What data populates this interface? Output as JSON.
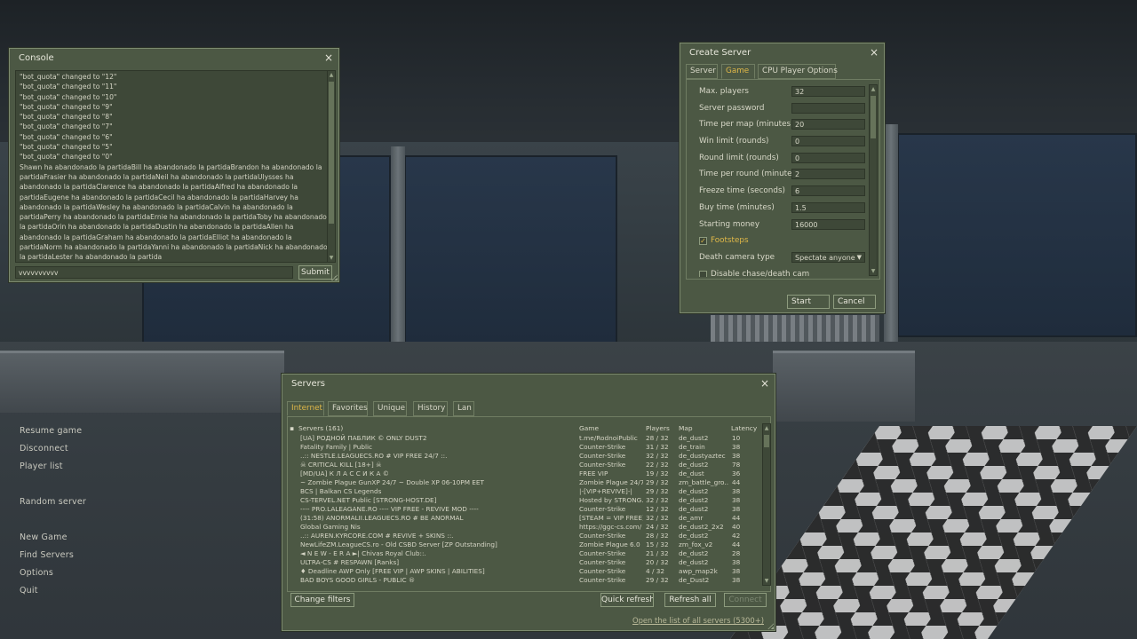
{
  "main_menu": {
    "items": [
      "Resume game",
      "Disconnect",
      "Player list",
      "",
      "Random server",
      "",
      "New Game",
      "Find Servers",
      "Options",
      "Quit"
    ]
  },
  "console": {
    "title": "Console",
    "close_glyph": "×",
    "lines": [
      "\"bot_quota\" changed to \"12\"",
      "\"bot_quota\" changed to \"11\"",
      "\"bot_quota\" changed to \"10\"",
      "\"bot_quota\" changed to \"9\"",
      "\"bot_quota\" changed to \"8\"",
      "\"bot_quota\" changed to \"7\"",
      "\"bot_quota\" changed to \"6\"",
      "\"bot_quota\" changed to \"5\"",
      "\"bot_quota\" changed to \"0\""
    ],
    "paragraph": "Shawn ha abandonado la partidaBill ha abandonado la partidaBrandon ha abandonado la partidaFrasier ha abandonado la partidaNeil ha abandonado la partidaUlysses ha abandonado la partidaClarence ha abandonado la partidaAlfred ha abandonado la partidaEugene ha abandonado la partidaCecil ha abandonado la partidaHarvey ha abandonado la partidaWesley ha abandonado la partidaCalvin ha abandonado la partidaPerry ha abandonado la partidaErnie ha abandonado la partidaToby ha abandonado la partidaOrin ha abandonado la partidaDustin ha abandonado la partidaAllen ha abandonado la partidaGraham ha abandonado la partidaElliot ha abandonado la partidaNorm ha abandonado la partidaYanni ha abandonado la partidaNick ha abandonado la partidaLester ha abandonado la partida",
    "input_value": "vvvvvvvvvv",
    "submit_label": "Submit"
  },
  "create_server": {
    "title": "Create Server",
    "close_glyph": "×",
    "tabs": [
      "Server",
      "Game",
      "CPU Player Options"
    ],
    "active_tab": "Game",
    "fields": [
      {
        "label": "Max. players",
        "value": "32"
      },
      {
        "label": "Server password",
        "value": ""
      },
      {
        "label": "Time per map (minutes)",
        "value": "20"
      },
      {
        "label": "Win limit (rounds)",
        "value": "0"
      },
      {
        "label": "Round limit (rounds)",
        "value": "0"
      },
      {
        "label": "Time per round (minutes)",
        "value": "2"
      },
      {
        "label": "Freeze time (seconds)",
        "value": "6"
      },
      {
        "label": "Buy time (minutes)",
        "value": "1.5"
      },
      {
        "label": "Starting money",
        "value": "16000"
      }
    ],
    "footsteps": {
      "label": "Footsteps",
      "checked": "✓"
    },
    "death_camera": {
      "label": "Death camera type",
      "value": "Spectate anyone"
    },
    "disable_chase": {
      "label": "Disable chase/death cam"
    },
    "start_label": "Start",
    "cancel_label": "Cancel"
  },
  "servers": {
    "title": "Servers",
    "close_glyph": "×",
    "tabs": [
      "Internet",
      "Favorites",
      "Unique",
      "History",
      "Lan"
    ],
    "active_tab": "Internet",
    "columns": {
      "name": "Servers (161)",
      "game": "Game",
      "players": "Players",
      "map": "Map",
      "latency": "Latency"
    },
    "rows": [
      {
        "name": "[UA] РОДНОЙ ПАБЛИК © ONLY DUST2",
        "game": "t.me/RodnoiPublic",
        "players": "28 / 32",
        "map": "de_dust2",
        "latency": "10"
      },
      {
        "name": "Fatality Family | Public",
        "game": "Counter-Strike",
        "players": "31 / 32",
        "map": "de_train",
        "latency": "38"
      },
      {
        "name": "..:: NESTLE.LEAGUECS.RO # VIP FREE 24/7 ::.",
        "game": "Counter-Strike",
        "players": "32 / 32",
        "map": "de_dustyaztec",
        "latency": "38"
      },
      {
        "name": "☠ CRITICAL KILL [18+] ☠",
        "game": "Counter-Strike",
        "players": "22 / 32",
        "map": "de_dust2",
        "latency": "78"
      },
      {
        "name": "[MD/UA] К Л А С С И К А ©",
        "game": "FREE VIP",
        "players": "19 / 32",
        "map": "de_dust",
        "latency": "36"
      },
      {
        "name": "~ Zombie Plague GunXP 24/7 ~ Double XP 06-10PM EET",
        "game": "Zombie Plague 24/7",
        "players": "29 / 32",
        "map": "zm_battle_gro...",
        "latency": "44"
      },
      {
        "name": "BCS | Balkan CS Legends",
        "game": "|-[VIP+REVIVE]-|",
        "players": "29 / 32",
        "map": "de_dust2",
        "latency": "38"
      },
      {
        "name": "CS-TERVEL.NET Public [STRONG-HOST.DE]",
        "game": "Hosted by STRONG...",
        "players": "32 / 32",
        "map": "de_dust2",
        "latency": "38"
      },
      {
        "name": "---- PRO.LALEAGANE.RO ---- VIP FREE - REVIVE MOD ----",
        "game": "Counter-Strike",
        "players": "12 / 32",
        "map": "de_dust2",
        "latency": "38"
      },
      {
        "name": "(31:58) ANORMALII.LEAGUECS.RO # BE ANORMAL",
        "game": "[STEAM = VIP FREE]",
        "players": "32 / 32",
        "map": "de_amr",
        "latency": "44"
      },
      {
        "name": "Global Gaming Nis",
        "game": "https://ggc-cs.com/",
        "players": "24 / 32",
        "map": "de_dust2_2x2",
        "latency": "40"
      },
      {
        "name": "..:: AUREN.KYRCORE.COM # REVIVE + SKINS ::.",
        "game": "Counter-Strike",
        "players": "28 / 32",
        "map": "de_dust2",
        "latency": "42"
      },
      {
        "name": "NewLifeZM.LeagueCS.ro - Old CSBD Server [ZP Outstanding]",
        "game": "Zombie Plague 6.0",
        "players": "15 / 32",
        "map": "zm_fox_v2",
        "latency": "44"
      },
      {
        "name": "◄ N E W - E R A ►| Chivas Royal Club::.",
        "game": "Counter-Strike",
        "players": "21 / 32",
        "map": "de_dust2",
        "latency": "28"
      },
      {
        "name": "ULTRA-CS # RESPAWN [Ranks]",
        "game": "Counter-Strike",
        "players": "20 / 32",
        "map": "de_dust2",
        "latency": "38"
      },
      {
        "name": "♦ Deadline AWP Only [FREE VIP | AWP SKINS | ABILITIES]",
        "game": "Counter-Strike",
        "players": "4 / 32",
        "map": "awp_map2k",
        "latency": "38"
      },
      {
        "name": "BAD BOYS  GOOD GIRLS - PUBLIC ®",
        "game": "Counter-Strike",
        "players": "29 / 32",
        "map": "de_Dust2",
        "latency": "38"
      }
    ],
    "change_filters_label": "Change filters",
    "quick_refresh_label": "Quick refresh",
    "refresh_all_label": "Refresh all",
    "connect_label": "Connect",
    "open_list_link": "Open the list of all servers (5300+)",
    "lock_glyph": "🔒"
  },
  "icons": {
    "close": "close-icon",
    "scroll_up": "▲",
    "scroll_down": "▼",
    "dropdown": "▼"
  },
  "colors": {
    "window_bg": "#4c5844",
    "field_bg": "#3e4838",
    "accent": "#e0b848",
    "text": "#d8d8c8"
  }
}
